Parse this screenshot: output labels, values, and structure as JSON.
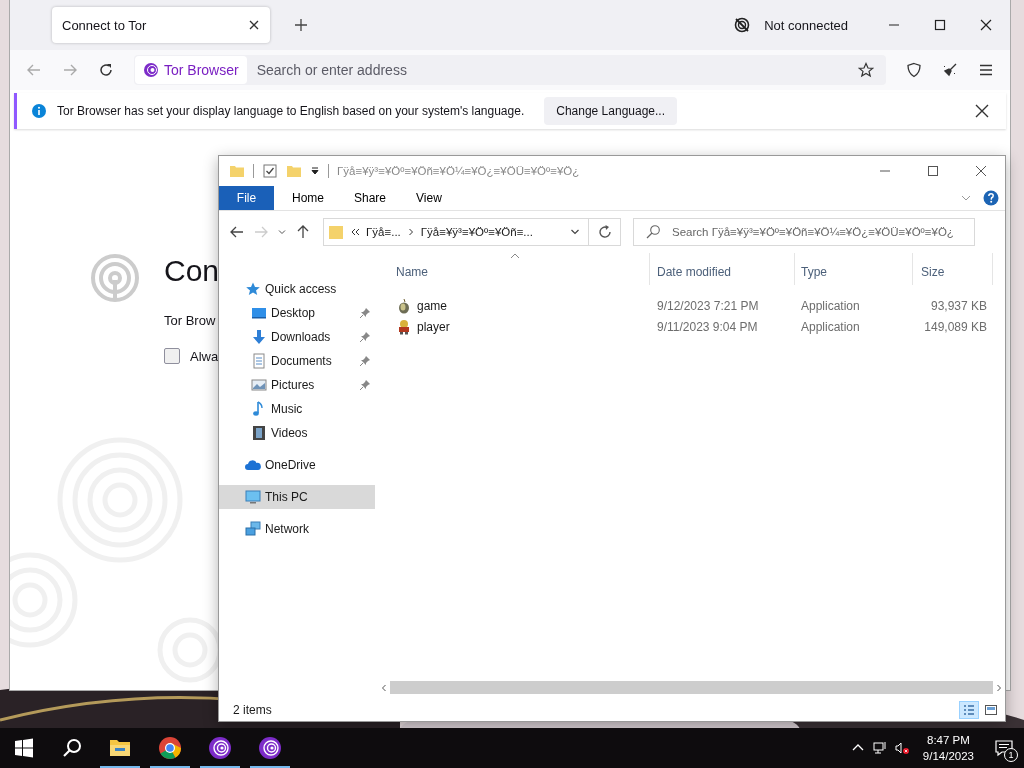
{
  "browser": {
    "tabs": [
      {
        "title": "Connect to Tor",
        "selected": true
      }
    ],
    "connection_status": "Not connected",
    "identity_label": "Tor Browser",
    "address_placeholder": "Search or enter address",
    "notification": {
      "message": "Tor Browser has set your display language to English based on your system's language.",
      "button": "Change Language..."
    },
    "page": {
      "heading": "Con",
      "text": "Tor Brow",
      "checkbox": {
        "label": "Alwa",
        "checked": false
      }
    }
  },
  "explorer": {
    "title": "Γÿå≡¥ÿ³≡¥Öº≡¥Öñ≡¥Ö¼≡¥Ö¿≡¥ÖÜ≡¥Öº≡¥Ö¿",
    "file_tab": "File",
    "ribbon_tabs": [
      "Home",
      "Share",
      "View"
    ],
    "breadcrumbs": [
      "Γÿå≡...",
      "Γÿå≡¥ÿ³≡¥Öº≡¥Öñ≡..."
    ],
    "search_placeholder": "Search Γÿå≡¥ÿ³≡¥Öº≡¥Öñ≡¥Ö¼≡¥Ö¿≡¥ÖÜ≡¥Öº≡¥Ö¿",
    "navigation": [
      {
        "label": "Quick access",
        "kind": "quick-access",
        "selected": false,
        "children": [
          {
            "label": "Desktop",
            "kind": "desktop",
            "pinned": true,
            "selected": false
          },
          {
            "label": "Downloads",
            "kind": "downloads",
            "pinned": true,
            "selected": false
          },
          {
            "label": "Documents",
            "kind": "documents",
            "pinned": true,
            "selected": false
          },
          {
            "label": "Pictures",
            "kind": "pictures",
            "pinned": true,
            "selected": false
          },
          {
            "label": "Music",
            "kind": "music",
            "pinned": false,
            "selected": false
          },
          {
            "label": "Videos",
            "kind": "videos",
            "pinned": false,
            "selected": false
          }
        ]
      },
      {
        "label": "OneDrive",
        "kind": "cloud",
        "selected": false
      },
      {
        "label": "This PC",
        "kind": "computer",
        "selected": true
      },
      {
        "label": "Network",
        "kind": "network",
        "selected": false
      }
    ],
    "columns": [
      {
        "label": "Name",
        "sorted": true
      },
      {
        "label": "Date modified",
        "sorted": false
      },
      {
        "label": "Type",
        "sorted": false
      },
      {
        "label": "Size",
        "sorted": false
      }
    ],
    "files": [
      {
        "name": "game",
        "date_modified": "9/12/2023 7:21 PM",
        "type": "Application",
        "size": "93,937 KB"
      },
      {
        "name": "player",
        "date_modified": "9/11/2023 9:04 PM",
        "type": "Application",
        "size": "149,089 KB"
      }
    ],
    "status": "2 items",
    "views": [
      {
        "kind": "details",
        "selected": true
      },
      {
        "kind": "large-icons",
        "selected": false
      }
    ]
  },
  "taskbar": {
    "apps": [
      {
        "kind": "file-explorer"
      },
      {
        "kind": "chrome"
      },
      {
        "kind": "tor"
      },
      {
        "kind": "tor"
      }
    ],
    "time": "8:47 PM",
    "date": "9/14/2023",
    "notification_count": "1"
  }
}
